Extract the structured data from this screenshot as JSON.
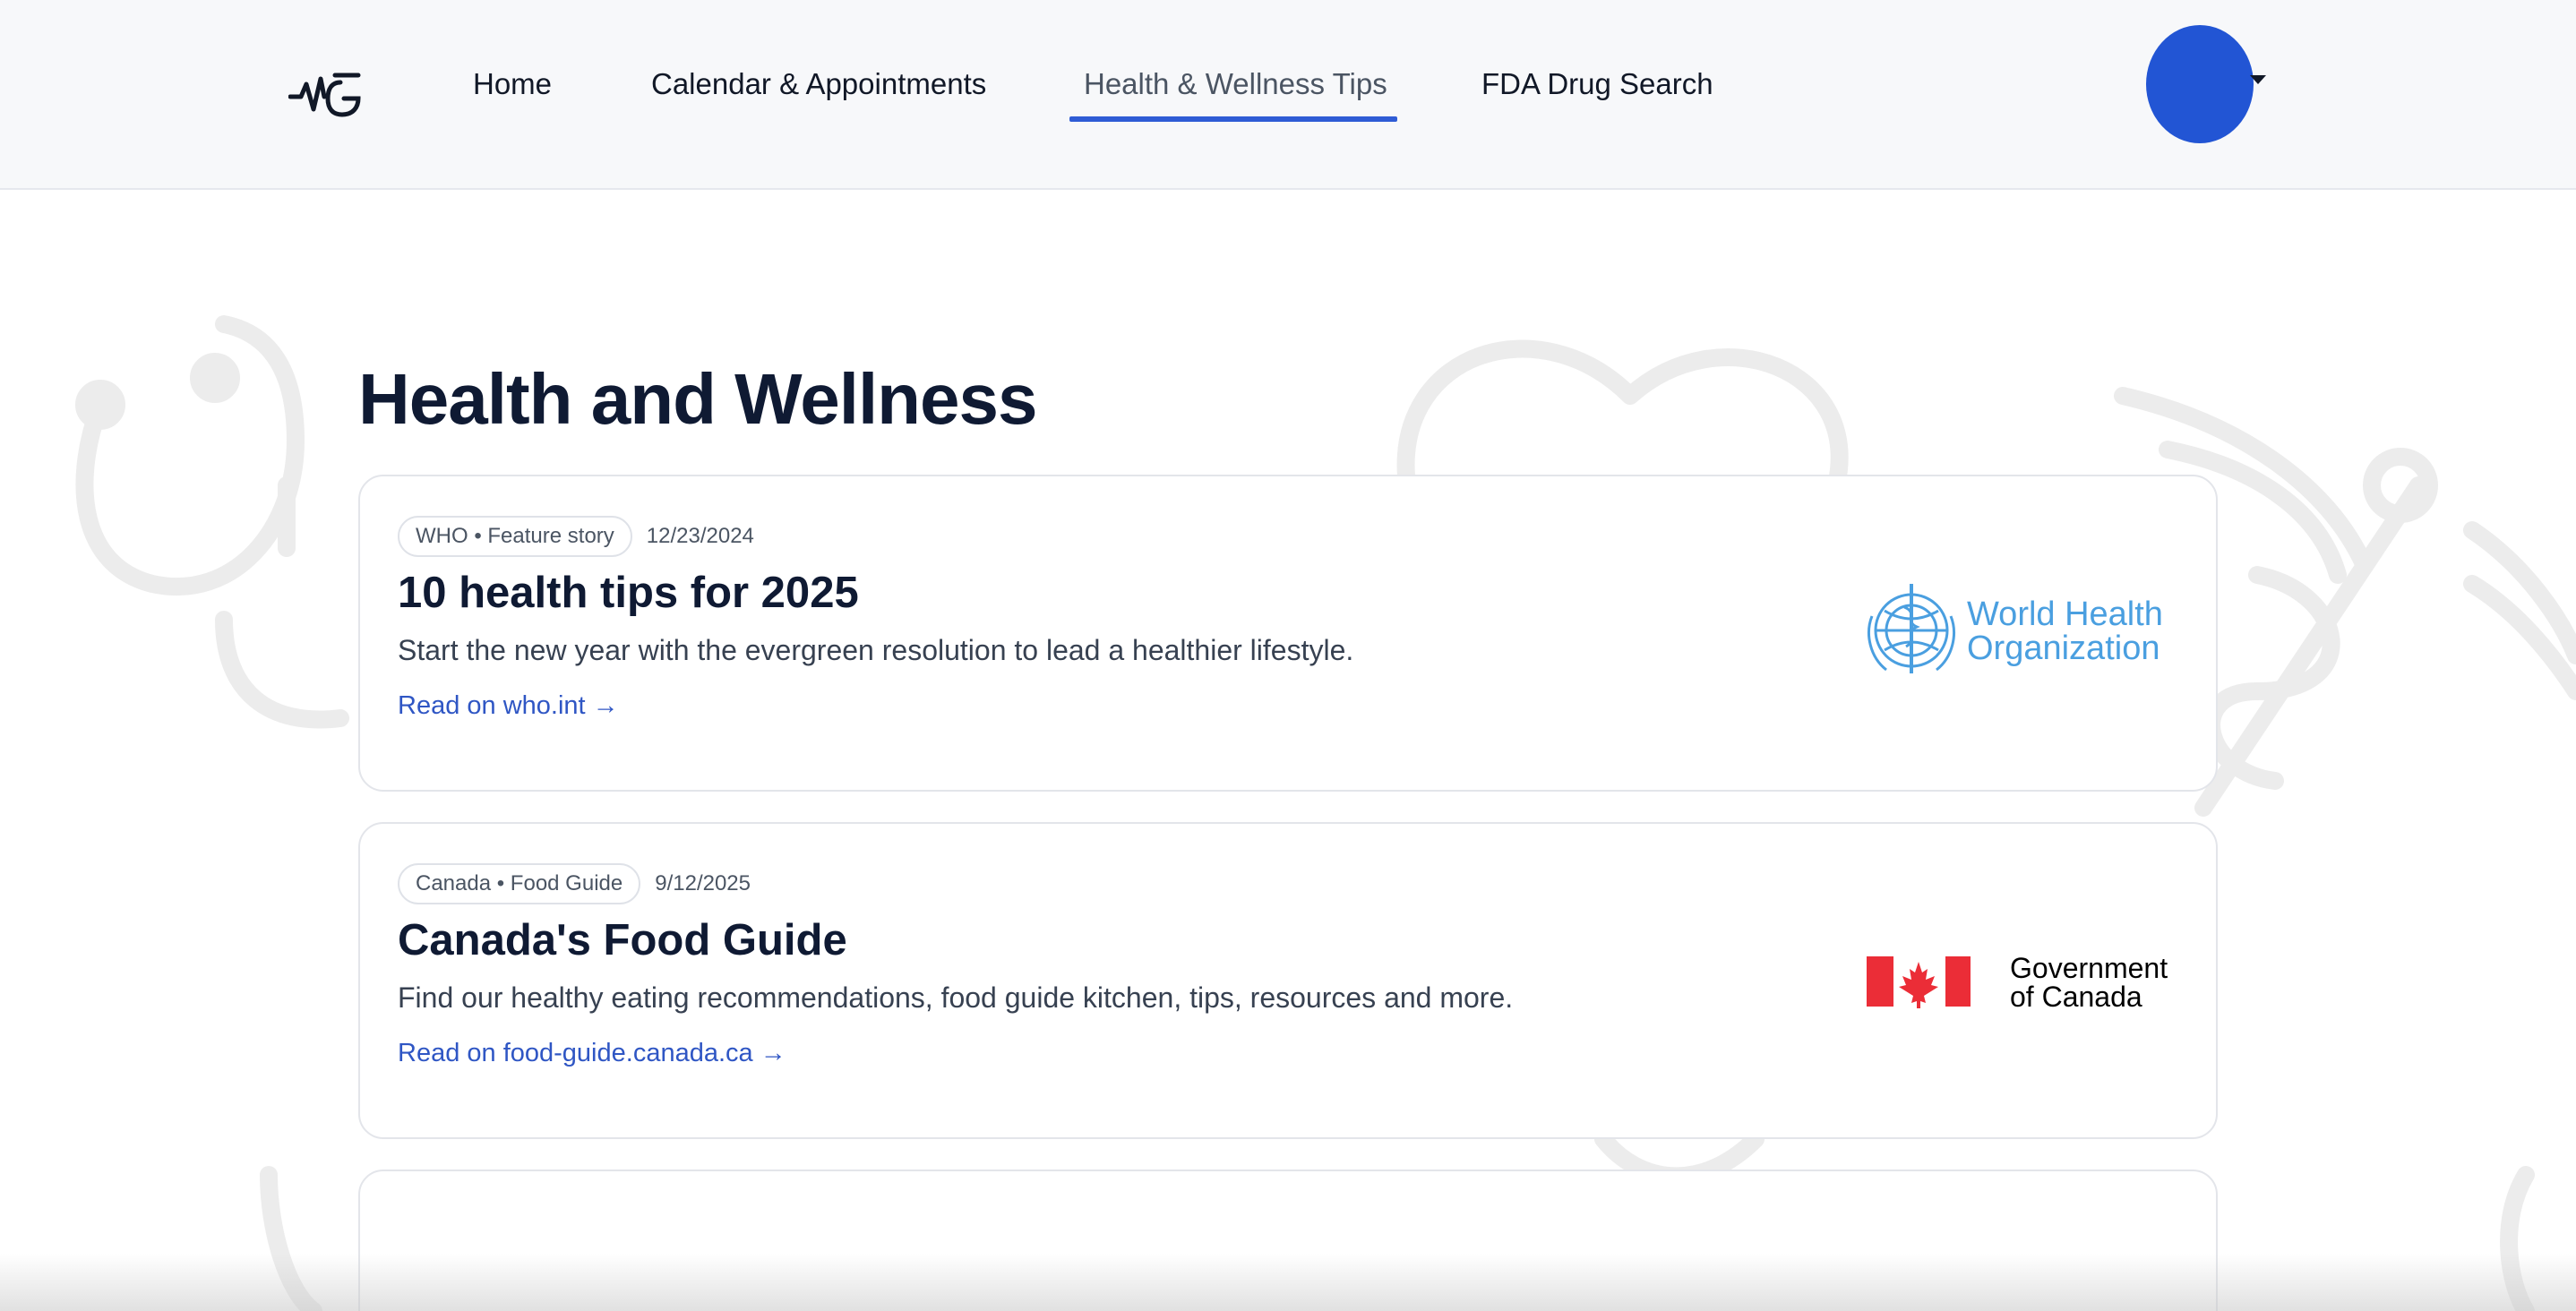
{
  "nav": {
    "items": [
      {
        "label": "Home"
      },
      {
        "label": "Calendar & Appointments"
      },
      {
        "label": "Health & Wellness Tips"
      },
      {
        "label": "FDA Drug Search"
      }
    ],
    "active_index": 2
  },
  "page": {
    "title": "Health and Wellness"
  },
  "cards": [
    {
      "tag": "WHO • Feature story",
      "date": "12/23/2024",
      "title": "10 health tips for 2025",
      "description": "Start the new year with the evergreen resolution to lead a healthier lifestyle.",
      "link": "Read on who.int →",
      "logo_text_1": "World Health",
      "logo_text_2": "Organization"
    },
    {
      "tag": "Canada • Food Guide",
      "date": "9/12/2025",
      "title": "Canada's Food Guide",
      "description": "Find our healthy eating recommendations, food guide kitchen, tips, resources and more.",
      "link": "Read on food-guide.canada.ca →",
      "logo_text_1": "Government",
      "logo_text_2": "of Canada"
    }
  ],
  "colors": {
    "accent": "#2f5cd5",
    "avatar": "#2255d4",
    "link": "#2f56c4",
    "who_blue": "#4a9fe0",
    "canada_red": "#eb2d37"
  }
}
